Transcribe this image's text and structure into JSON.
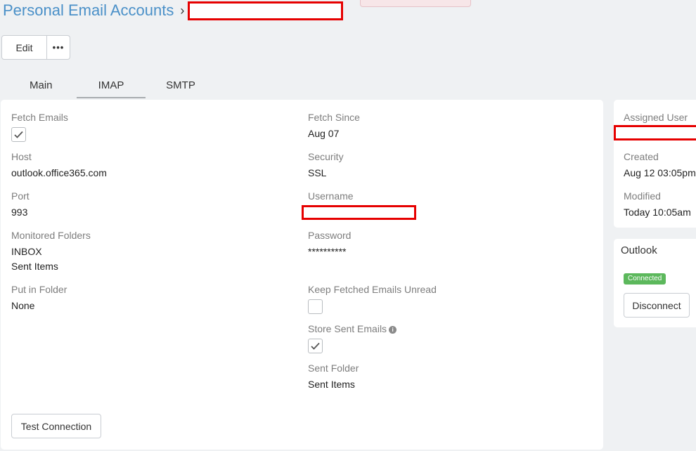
{
  "header": {
    "breadcrumb_root": "Personal Email Accounts",
    "separator": "›"
  },
  "toolbar": {
    "edit_label": "Edit",
    "more_label": "•••"
  },
  "tabs": [
    {
      "label": "Main"
    },
    {
      "label": "IMAP"
    },
    {
      "label": "SMTP"
    }
  ],
  "imap": {
    "fetch_emails": {
      "label": "Fetch Emails",
      "checked": true
    },
    "fetch_since": {
      "label": "Fetch Since",
      "value": "Aug 07"
    },
    "host": {
      "label": "Host",
      "value": "outlook.office365.com"
    },
    "security": {
      "label": "Security",
      "value": "SSL"
    },
    "port": {
      "label": "Port",
      "value": "993"
    },
    "username": {
      "label": "Username"
    },
    "monitored_folders": {
      "label": "Monitored Folders",
      "values": [
        "INBOX",
        "Sent Items"
      ]
    },
    "password": {
      "label": "Password",
      "value": "**********"
    },
    "put_in_folder": {
      "label": "Put in Folder",
      "value": "None"
    },
    "keep_unread": {
      "label": "Keep Fetched Emails Unread",
      "checked": false
    },
    "store_sent": {
      "label": "Store Sent Emails",
      "checked": true
    },
    "sent_folder": {
      "label": "Sent Folder",
      "value": "Sent Items"
    },
    "test_button": "Test Connection"
  },
  "side": {
    "assigned_user": {
      "label": "Assigned User"
    },
    "created": {
      "label": "Created",
      "value": "Aug 12 03:05pm"
    },
    "modified": {
      "label": "Modified",
      "value": "Today 10:05am"
    }
  },
  "outlook": {
    "title": "Outlook",
    "status": "Connected",
    "status_color": "#5cb85c",
    "disconnect_label": "Disconnect"
  }
}
